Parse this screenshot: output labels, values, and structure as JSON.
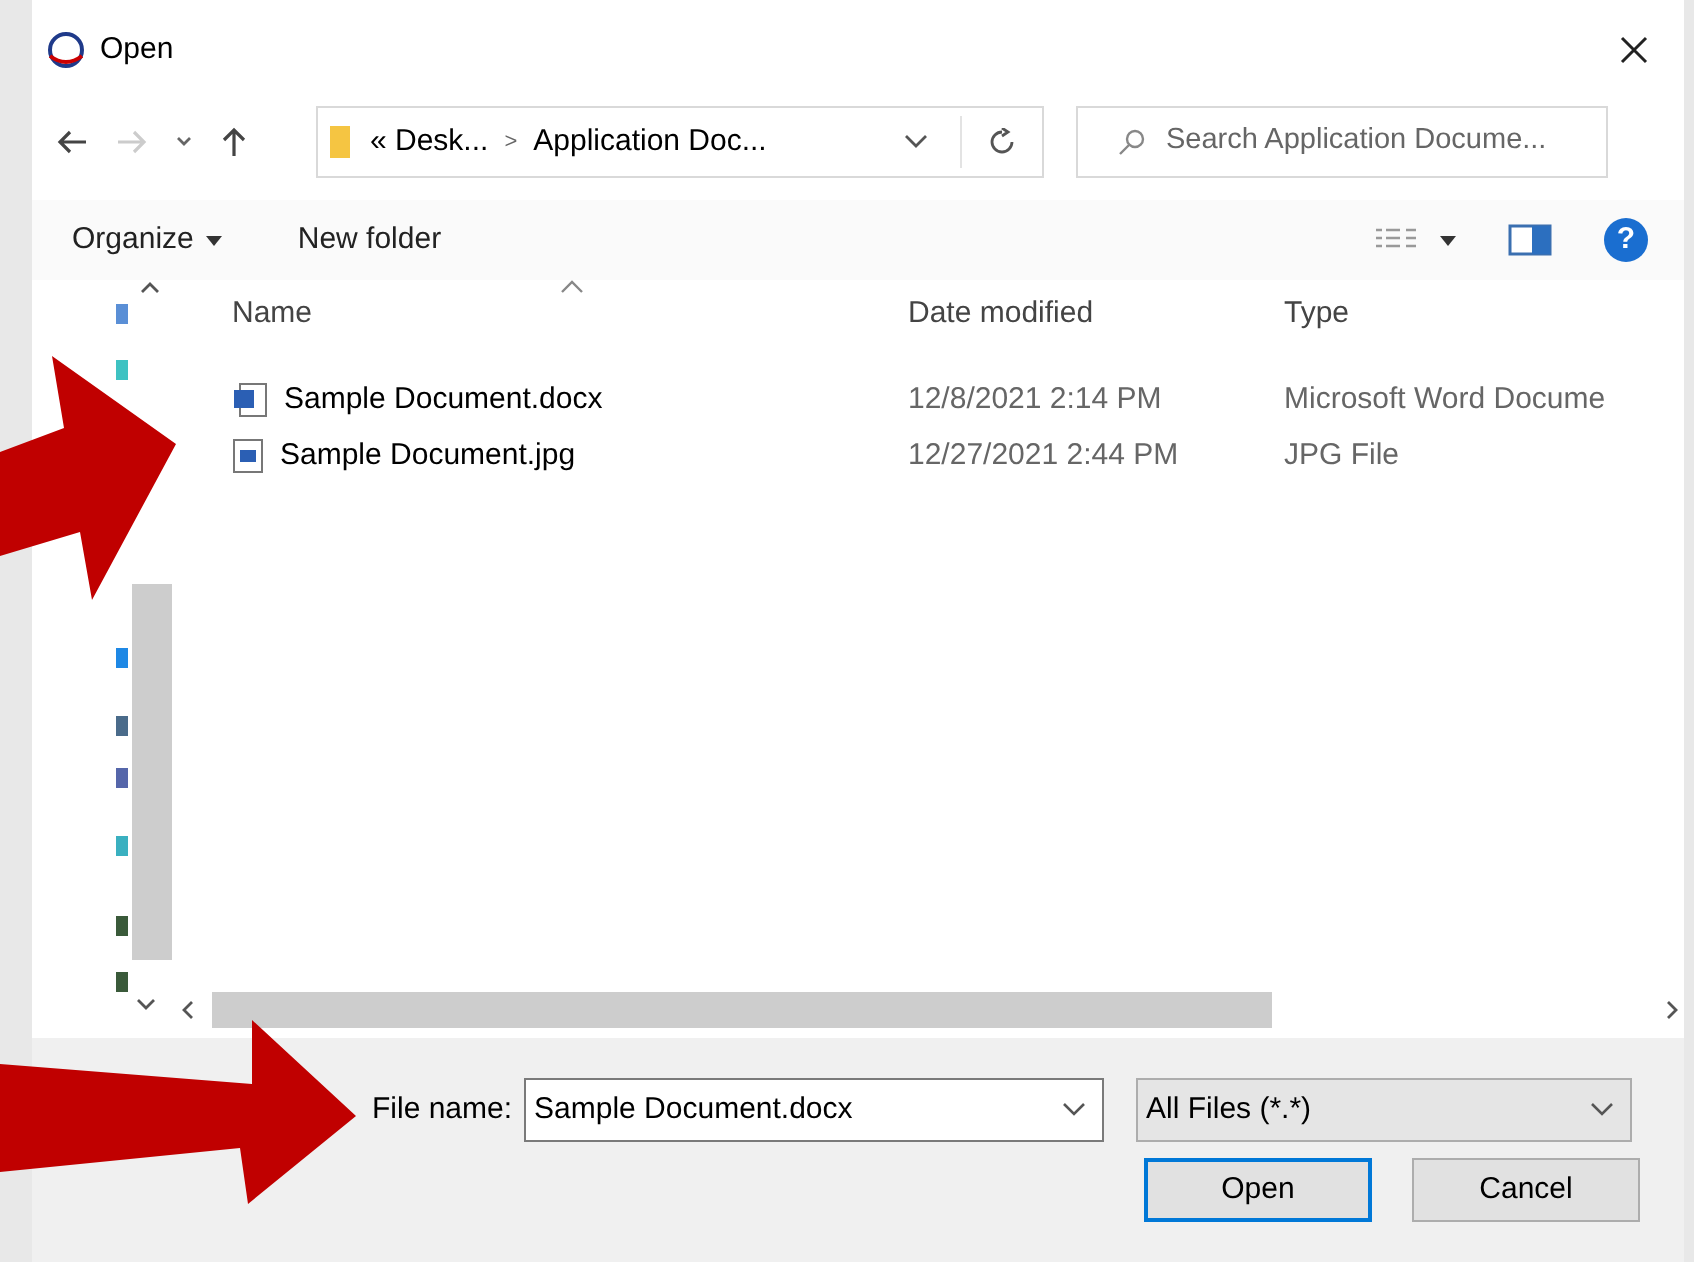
{
  "window": {
    "title": "Open"
  },
  "address_bar": {
    "breadcrumb": [
      {
        "text": "« Desk..."
      },
      {
        "text": "Application Doc..."
      }
    ],
    "separator": ">"
  },
  "search": {
    "placeholder": "Search Application Docume..."
  },
  "toolbar": {
    "organize": "Organize",
    "new_folder": "New folder",
    "help": "?"
  },
  "table": {
    "columns": [
      "Name",
      "Date modified",
      "Type"
    ],
    "rows": [
      {
        "kind": "word",
        "name": "Sample Document.docx",
        "date": "12/8/2021 2:14 PM",
        "type": "Microsoft Word Docume"
      },
      {
        "kind": "image",
        "name": "Sample Document.jpg",
        "date": "12/27/2021 2:44 PM",
        "type": "JPG File"
      }
    ]
  },
  "file_name": {
    "label": "File name:",
    "value": "Sample Document.docx"
  },
  "filter": {
    "value": "All Files (*.*)"
  },
  "buttons": [
    {
      "label": "Open",
      "focused": true
    },
    {
      "label": "Cancel",
      "focused": false
    }
  ]
}
